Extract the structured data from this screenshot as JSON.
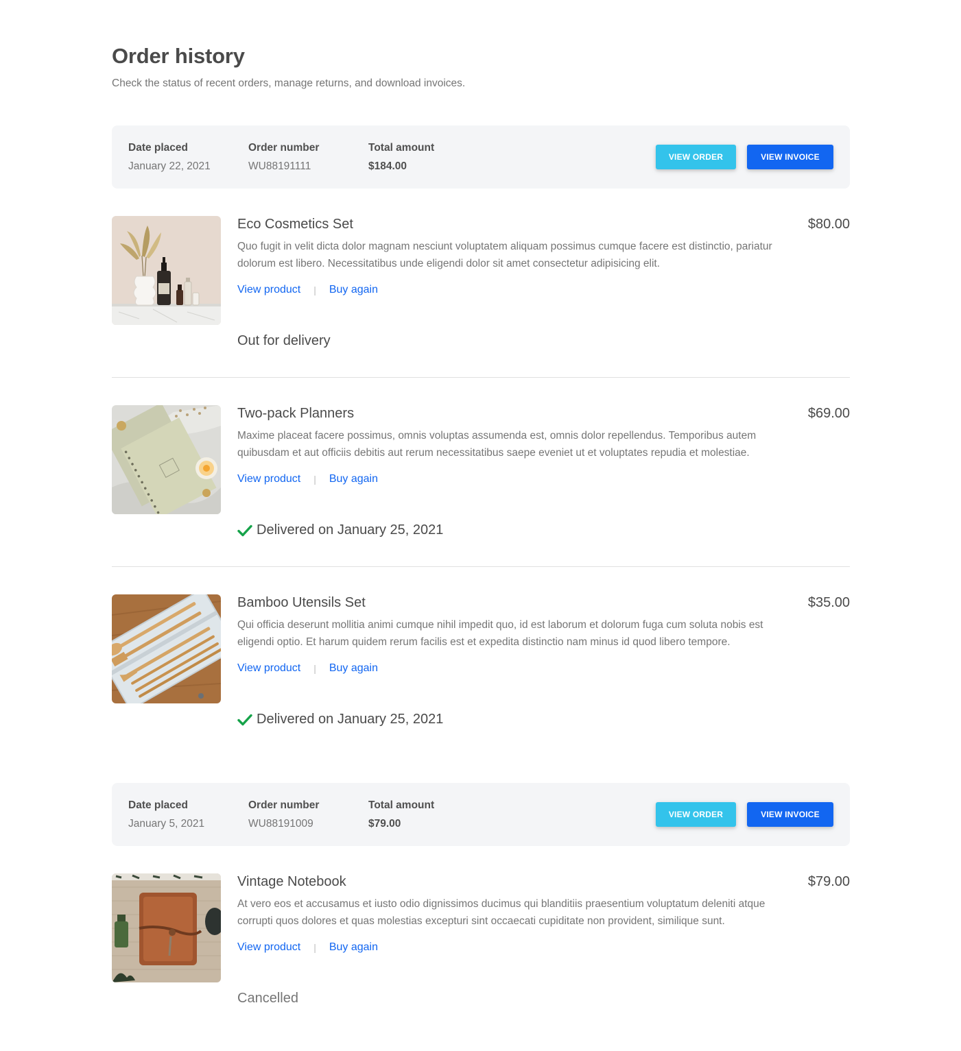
{
  "header": {
    "title": "Order history",
    "subtitle": "Check the status of recent orders, manage returns, and download invoices."
  },
  "labels": {
    "date_placed": "Date placed",
    "order_number": "Order number",
    "total_amount": "Total amount",
    "view_order": "VIEW ORDER",
    "view_invoice": "VIEW INVOICE",
    "view_product": "View product",
    "buy_again": "Buy again",
    "separator": "|"
  },
  "orders": [
    {
      "date_placed": "January 22, 2021",
      "order_number": "WU88191111",
      "total_amount": "$184.00",
      "items": [
        {
          "name": "Eco Cosmetics Set",
          "price": "$80.00",
          "description": "Quo fugit in velit dicta dolor magnam nesciunt voluptatem aliquam possimus cumque facere est distinctio, pariatur dolorum est libero. Necessitatibus unde eligendi dolor sit amet consectetur adipisicing elit.",
          "status": "Out for delivery",
          "image": "cosmetics-photo"
        },
        {
          "name": "Two-pack Planners",
          "price": "$69.00",
          "description": "Maxime placeat facere possimus, omnis voluptas assumenda est, omnis dolor repellendus. Temporibus autem quibusdam et aut officiis debitis aut rerum necessitatibus saepe eveniet ut et voluptates repudia et molestiae.",
          "status": "Delivered on January 25, 2021",
          "image": "planner-photo"
        },
        {
          "name": "Bamboo Utensils Set",
          "price": "$35.00",
          "description": "Qui officia deserunt mollitia animi cumque nihil impedit quo, id est laborum et dolorum fuga cum soluta nobis est eligendi optio. Et harum quidem rerum facilis est et expedita distinctio nam minus id quod libero tempore.",
          "status": "Delivered on January 25, 2021",
          "image": "utensils-photo"
        }
      ]
    },
    {
      "date_placed": "January 5, 2021",
      "order_number": "WU88191009",
      "total_amount": "$79.00",
      "items": [
        {
          "name": "Vintage Notebook",
          "price": "$79.00",
          "description": "At vero eos et accusamus et iusto odio dignissimos ducimus qui blanditiis praesentium voluptatum deleniti atque corrupti quos dolores et quas molestias excepturi sint occaecati cupiditate non provident, similique sunt.",
          "status": "Cancelled",
          "image": "notebook-photo"
        }
      ]
    }
  ],
  "colors": {
    "primary": "#1266f1",
    "info": "#33c3eb",
    "success": "#16a34a"
  }
}
